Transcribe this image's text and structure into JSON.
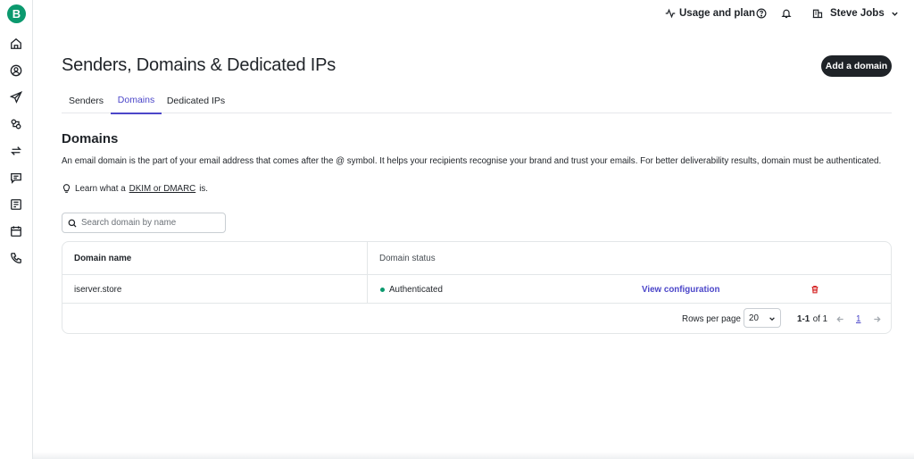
{
  "sidebar": {
    "logo_letter": "B",
    "items": [
      {
        "icon": "home-icon"
      },
      {
        "icon": "contacts-icon"
      },
      {
        "icon": "send-icon"
      },
      {
        "icon": "automation-icon"
      },
      {
        "icon": "transactional-icon"
      },
      {
        "icon": "conversations-icon"
      },
      {
        "icon": "sales-icon"
      },
      {
        "icon": "meetings-icon"
      },
      {
        "icon": "phone-icon"
      }
    ]
  },
  "topbar": {
    "usage_label": "Usage and plan",
    "user_name": "Steve Jobs"
  },
  "page": {
    "title": "Senders, Domains & Dedicated IPs",
    "add_button": "Add a domain"
  },
  "tabs": [
    {
      "label": "Senders",
      "active": false
    },
    {
      "label": "Domains",
      "active": true
    },
    {
      "label": "Dedicated IPs",
      "active": false
    }
  ],
  "section": {
    "title": "Domains",
    "description": "An email domain is the part of your email address that comes after the @ symbol. It helps your recipients recognise your brand and trust your emails. For better deliverability results, domain must be authenticated.",
    "learn_prefix": "Learn what a",
    "learn_link": "DKIM or DMARC",
    "learn_suffix": "is."
  },
  "search": {
    "placeholder": "Search domain by name",
    "value": ""
  },
  "table": {
    "columns": [
      "Domain name",
      "Domain status"
    ],
    "rows": [
      {
        "domain": "iserver.store",
        "status": "Authenticated",
        "status_color": "#0b996e",
        "action": "View configuration"
      }
    ]
  },
  "pagination": {
    "rows_per_page_label": "Rows per page",
    "rows_per_page_value": "20",
    "range": "1-1",
    "of_label": "of 1",
    "current_page": "1"
  },
  "colors": {
    "accent": "#4b46c9",
    "brand": "#0b996e",
    "danger": "#d62b2b",
    "dark": "#1f2328"
  }
}
